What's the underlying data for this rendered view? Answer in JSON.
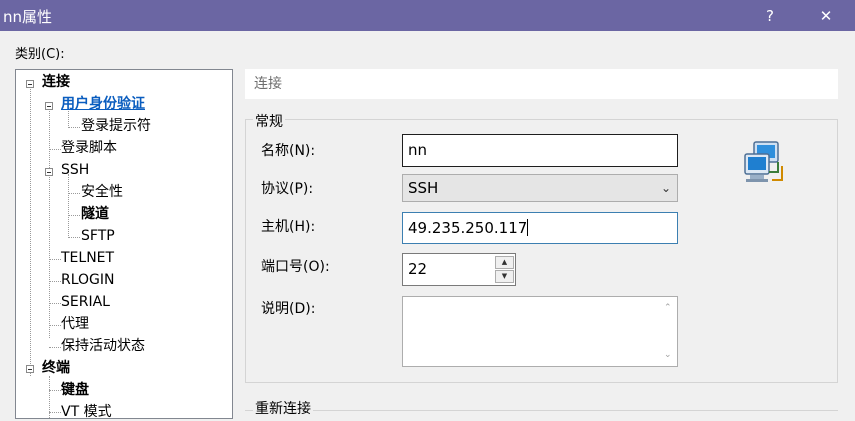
{
  "window": {
    "title": "nn属性",
    "help_label": "?",
    "close_label": "✕"
  },
  "category_label": "类别(C):",
  "tree": {
    "items": [
      {
        "label": "连接"
      },
      {
        "label": "用户身份验证"
      },
      {
        "label": "登录提示符"
      },
      {
        "label": "登录脚本"
      },
      {
        "label": "SSH"
      },
      {
        "label": "安全性"
      },
      {
        "label": "隧道"
      },
      {
        "label": "SFTP"
      },
      {
        "label": "TELNET"
      },
      {
        "label": "RLOGIN"
      },
      {
        "label": "SERIAL"
      },
      {
        "label": "代理"
      },
      {
        "label": "保持活动状态"
      },
      {
        "label": "终端"
      },
      {
        "label": "键盘"
      },
      {
        "label": "VT 模式"
      }
    ]
  },
  "section_header": "连接",
  "general": {
    "title": "常规",
    "name_label": "名称(N):",
    "name_value": "nn",
    "protocol_label": "协议(P):",
    "protocol_value": "SSH",
    "host_label": "主机(H):",
    "host_value": "49.235.250.117",
    "port_label": "端口号(O):",
    "port_value": "22",
    "description_label": "说明(D):",
    "description_value": ""
  },
  "reconnect_title": "重新连接",
  "icons": {
    "network": "network-computers-icon",
    "accent": "#6b66a3"
  }
}
